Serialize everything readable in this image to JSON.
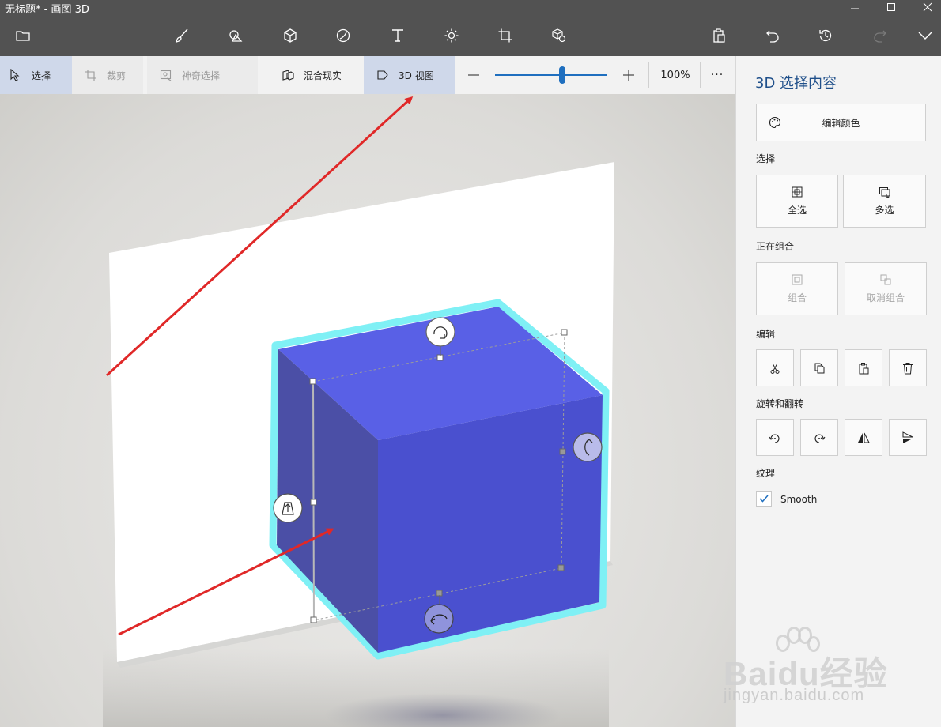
{
  "window": {
    "title": "无标题* - 画图 3D"
  },
  "toolbar": {
    "icons": [
      "menu-folder-icon",
      "brushes-icon",
      "2d-shapes-icon",
      "3d-shapes-icon",
      "stickers-icon",
      "text-icon",
      "effects-icon",
      "canvas-icon",
      "3d-library-icon",
      "paste-icon",
      "undo-icon",
      "history-icon",
      "redo-icon",
      "expand-icon"
    ]
  },
  "subbar": {
    "select": "选择",
    "crop": "裁剪",
    "magic_select": "神奇选择",
    "mixed_reality": "混合现实",
    "view_3d": "3D 视图",
    "zoom_level": "100%",
    "zoom_fraction": 0.6,
    "more": "···"
  },
  "panel": {
    "title": "3D 选择内容",
    "edit_color": "编辑颜色",
    "select_header": "选择",
    "select_all": "全选",
    "multi_select": "多选",
    "group_header": "正在组合",
    "group": "组合",
    "ungroup": "取消组合",
    "edit_header": "编辑",
    "rotate_flip_header": "旋转和翻转",
    "texture_header": "纹理",
    "smooth_label": "Smooth",
    "smooth_checked": true
  },
  "watermark": {
    "brand": "Baidu经验",
    "url": "jingyan.baidu.com"
  },
  "colors": {
    "accent": "#1f6fbf",
    "cube": "#4f56d6",
    "outline": "#7ff0f5",
    "arrow": "#e02828"
  }
}
